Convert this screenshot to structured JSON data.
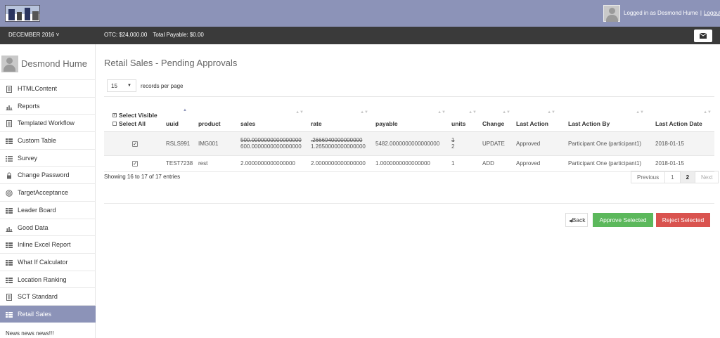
{
  "header": {
    "logged_in_text": "Logged in as Desmond Hume",
    "separator": "|",
    "logout_label": "Logout"
  },
  "bar": {
    "period": "DECEMBER 2016 ˅",
    "otc": "OTC: $24,000.00",
    "total_payable": "Total Payable: $0.00"
  },
  "sidebar": {
    "user_name": "Desmond Hume",
    "items": [
      {
        "label": "HTMLContent",
        "icon": "document-icon"
      },
      {
        "label": "Reports",
        "icon": "bar-chart-icon"
      },
      {
        "label": "Templated Workflow",
        "icon": "document-icon"
      },
      {
        "label": "Custom Table",
        "icon": "table-icon"
      },
      {
        "label": "Survey",
        "icon": "list-icon"
      },
      {
        "label": "Change Password",
        "icon": "lock-icon"
      },
      {
        "label": "TargetAcceptance",
        "icon": "target-icon"
      },
      {
        "label": "Leader Board",
        "icon": "table-icon"
      },
      {
        "label": "Good Data",
        "icon": "bar-chart-icon"
      },
      {
        "label": "Inline Excel Report",
        "icon": "table-icon"
      },
      {
        "label": "What If Calculator",
        "icon": "table-icon"
      },
      {
        "label": "Location Ranking",
        "icon": "table-icon"
      },
      {
        "label": "SCT Standard",
        "icon": "document-icon"
      },
      {
        "label": "Retail Sales",
        "icon": "table-icon"
      }
    ],
    "active": "Retail Sales",
    "news": "News news news!!!"
  },
  "main": {
    "title": "Retail Sales - Pending Approvals",
    "per_page": "15",
    "per_page_label": "records per page",
    "select_visible": "Select Visible",
    "select_all": "Select All",
    "columns": [
      "uuid",
      "product",
      "sales",
      "rate",
      "payable",
      "units",
      "Change",
      "Last Action",
      "Last Action By",
      "Last Action Date"
    ],
    "rows": [
      {
        "checked": true,
        "uuid": "RSLS991",
        "product": "IMG001",
        "sales_old": "500.0000000000000000",
        "sales": "600.0000000000000000",
        "rate_old": ".2666940000000000",
        "rate": "1.2650000000000000",
        "payable": "5482.0000000000000000",
        "units_old": "1",
        "units": "2",
        "change": "UPDATE",
        "last_action": "Approved",
        "last_action_by": "Participant One (participant1)",
        "last_action_date": "2018-01-15"
      },
      {
        "checked": true,
        "uuid": "TEST7238",
        "product": "rest",
        "sales": "2.0000000000000000",
        "rate": "2.0000000000000000",
        "payable": "1.0000000000000000",
        "units": "1",
        "change": "ADD",
        "last_action": "Approved",
        "last_action_by": "Participant One (participant1)",
        "last_action_date": "2018-01-15"
      }
    ],
    "showing": "Showing 16 to 17 of 17 entries",
    "pager": {
      "previous": "Previous",
      "p1": "1",
      "p2": "2",
      "next": "Next"
    },
    "back_label": "Back",
    "approve_label": "Approve Selected",
    "reject_label": "Reject Selected"
  },
  "colors": {
    "header": "#8c93b8",
    "darkbar": "#3a3a3a",
    "approve": "#5cb85c",
    "reject": "#d9534f"
  }
}
